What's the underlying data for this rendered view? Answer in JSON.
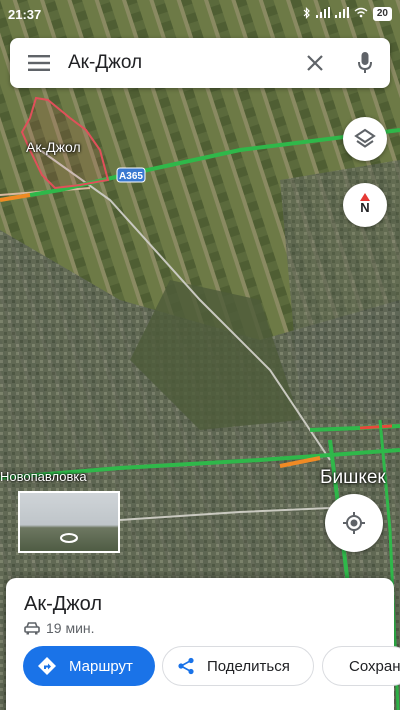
{
  "status_bar": {
    "time": "21:37",
    "battery": "20"
  },
  "search": {
    "query": "Ак-Джол"
  },
  "map": {
    "labels": {
      "akjol": "Ак-Джол",
      "road": "A365",
      "novopavlovka": "Новопавловка",
      "bishkek": "Бишкек"
    },
    "compass_letter": "N"
  },
  "place_card": {
    "title": "Ак-Джол",
    "eta": "19 мин.",
    "actions": {
      "route": "Маршрут",
      "share": "Поделиться",
      "save": "Сохранить"
    }
  },
  "colors": {
    "accent": "#1a73e8",
    "traffic_green": "#2fb84a",
    "traffic_orange": "#f08a24",
    "area_outline": "#e0505a"
  }
}
